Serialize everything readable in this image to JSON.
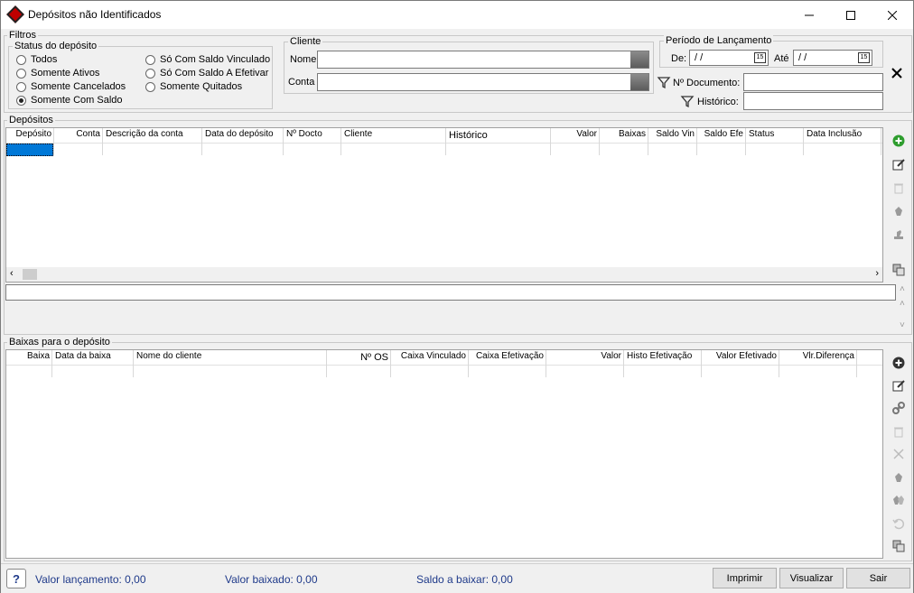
{
  "window": {
    "title": "Depósitos não Identificados"
  },
  "filters": {
    "legend": "Filtros",
    "status": {
      "legend": "Status do depósito",
      "options": [
        {
          "label": "Todos",
          "checked": false
        },
        {
          "label": "Somente Ativos",
          "checked": false
        },
        {
          "label": "Somente Cancelados",
          "checked": false
        },
        {
          "label": "Somente Com Saldo",
          "checked": true
        },
        {
          "label": "Só Com Saldo Vinculado",
          "checked": false
        },
        {
          "label": "Só Com Saldo A Efetivar",
          "checked": false
        },
        {
          "label": "Somente Quitados",
          "checked": false
        }
      ]
    },
    "cliente": {
      "legend": "Cliente",
      "nome_label": "Nome",
      "conta_label": "Conta",
      "nome_value": "",
      "conta_value": ""
    },
    "periodo": {
      "legend": "Período de Lançamento",
      "de_label": "De:",
      "ate_label": "Até",
      "de_value": " / /",
      "ate_value": " / /",
      "cal_glyph": "15"
    },
    "documento_label": "Nº Documento:",
    "historico_label": "Histórico:"
  },
  "depositos": {
    "legend": "Depósitos",
    "columns": [
      "Depósito",
      "Conta",
      "Descrição da conta",
      "Data do depósito",
      "Nº Docto",
      "Cliente",
      "Histórico",
      "Valor",
      "Baixas",
      "Saldo Vin",
      "Saldo Efe",
      "Status",
      "Data Inclusão"
    ]
  },
  "baixas": {
    "legend": "Baixas para o depósito",
    "columns": [
      "Baixa",
      "Data da baixa",
      "Nome do cliente",
      "Nº OS",
      "Caixa Vinculado",
      "Caixa Efetivação",
      "Valor",
      "Histo Efetivação",
      "Valor Efetivado",
      "Vlr.Diferença"
    ]
  },
  "status": {
    "valor_lancamento": "Valor lançamento: 0,00",
    "valor_baixado": "Valor baixado: 0,00",
    "saldo_a_baixar": "Saldo a baixar: 0,00"
  },
  "buttons": {
    "imprimir": "Imprimir",
    "visualizar": "Visualizar",
    "sair": "Sair"
  },
  "colors": {
    "accent_green": "#2e9d2e",
    "status_text": "#1f3a8a",
    "title_icon": "#c00000"
  }
}
